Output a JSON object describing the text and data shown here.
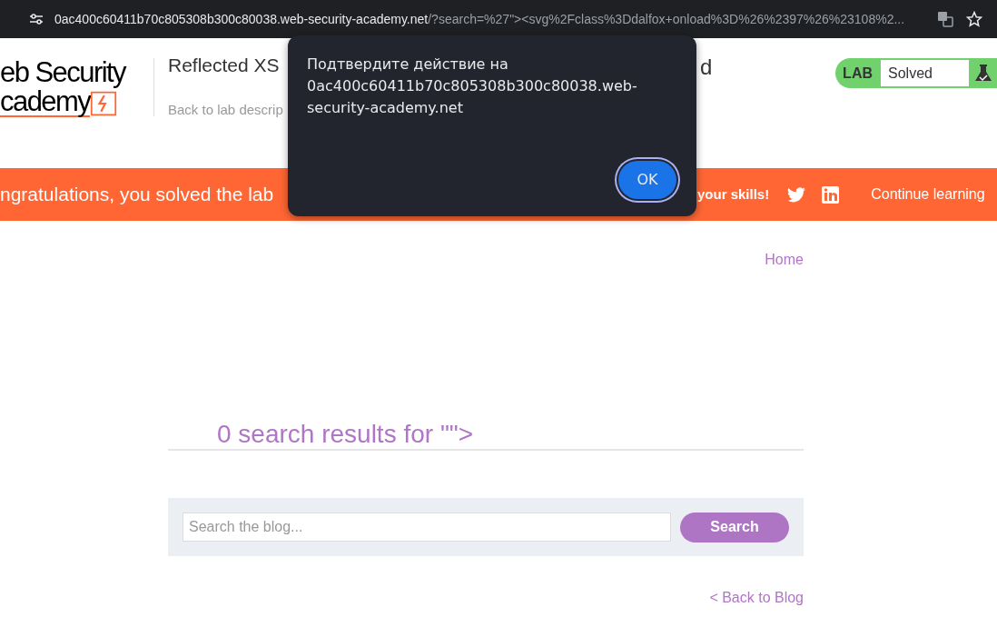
{
  "browser": {
    "url_host": "0ac400c60411b70c805308b300c80038.web-security-academy.net",
    "url_path": "/?search=%27\"><svg%2Fclass%3Ddalfox+onload%3D%26%2397%26%23108%2..."
  },
  "header": {
    "logo_line_1": "eb Security",
    "logo_line_2": "cademy",
    "title_start": "Reflected XS",
    "title_end": "d",
    "back_link": "Back to lab descrip",
    "lab_label": "LAB",
    "lab_status": "Solved"
  },
  "banner": {
    "message": "ngratulations, you solved the lab",
    "share_text": "your skills!",
    "continue_link": "Continue learning"
  },
  "nav": {
    "home_link": "Home"
  },
  "results_heading": "0 search results for \"\">",
  "search": {
    "placeholder": "Search the blog...",
    "button": "Search"
  },
  "back_link": "< Back to Blog",
  "dialog": {
    "message": "Подтвердите действие на 0ac400c60411b70c805308b300c80038.web-security-academy.net",
    "ok_button": "OK"
  }
}
